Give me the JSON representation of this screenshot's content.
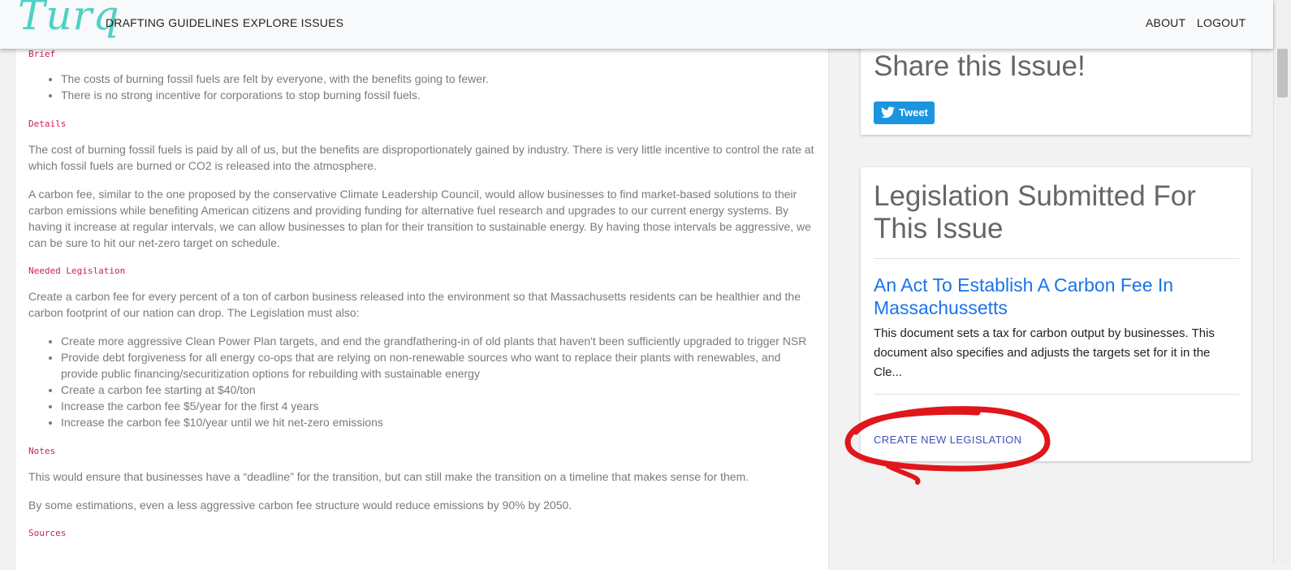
{
  "nav": {
    "logo": "Turq",
    "links": [
      "DRAFTING GUIDELINES",
      "EXPLORE ISSUES"
    ],
    "right_links": [
      "ABOUT",
      "LOGOUT"
    ]
  },
  "main": {
    "brief_heading": "Brief",
    "brief_items": [
      "The costs of burning fossil fuels are felt by everyone, with the benefits going to fewer.",
      "There is no strong incentive for corporations to stop burning fossil fuels."
    ],
    "details_heading": "Details",
    "details_paragraphs": [
      "The cost of burning fossil fuels is paid by all of us, but the benefits are disproportionately gained by industry. There is very little incentive to control the rate at which fossil fuels are burned or CO2 is released into the atmosphere.",
      "A carbon fee, similar to the one proposed by the conservative Climate Leadership Council, would allow businesses to find market-based solutions to their carbon emissions while benefiting American citizens and providing funding for alternative fuel research and upgrades to our current energy systems. By having it increase at regular intervals, we can allow businesses to plan for their transition to sustainable energy. By having those intervals be aggressive, we can be sure to hit our net-zero target on schedule."
    ],
    "needed_heading": "Needed Legislation",
    "needed_intro": "Create a carbon fee for every percent of a ton of carbon business released into the environment so that Massachusetts residents can be healthier and the carbon footprint of our nation can drop. The Legislation must also:",
    "needed_items": [
      "Create more aggressive Clean Power Plan targets, and end the grandfathering-in of old plants that haven't been sufficiently upgraded to trigger NSR",
      "Provide debt forgiveness for all energy co-ops that are relying on non-renewable sources who want to replace their plants with renewables, and provide public financing/securitization options for rebuilding with sustainable energy",
      "Create a carbon fee starting at $40/ton",
      "Increase the carbon fee $5/year for the first 4 years",
      "Increase the carbon fee $10/year until we hit net-zero emissions"
    ],
    "notes_heading": "Notes",
    "notes_paragraphs": [
      "This would ensure that businesses have a “deadline” for the transition, but can still make the transition on a timeline that makes sense for them.",
      "By some estimations, even a less aggressive carbon fee structure would reduce emissions by 90% by 2050."
    ],
    "sources_heading": "Sources"
  },
  "share_card": {
    "title": "Share this Issue!",
    "tweet_label": "Tweet"
  },
  "legislation_card": {
    "title_line1": "Legislation Submitted For",
    "title_line2": "This Issue",
    "item_title": "An Act To Establish A Carbon Fee In Massachussetts",
    "item_description": "This document sets a tax for carbon output by businesses. This document also specifies and adjusts the targets set for it in the Cle...",
    "create_label": "CREATE NEW LEGISLATION"
  },
  "colors": {
    "logo": "#4fd1c5",
    "code_heading": "#c7254e",
    "link": "#1a73e8",
    "tweet": "#1b95e0",
    "create_button": "#3f51b5",
    "annotation": "#e0161b"
  },
  "icons": [
    "twitter-bird-icon"
  ]
}
